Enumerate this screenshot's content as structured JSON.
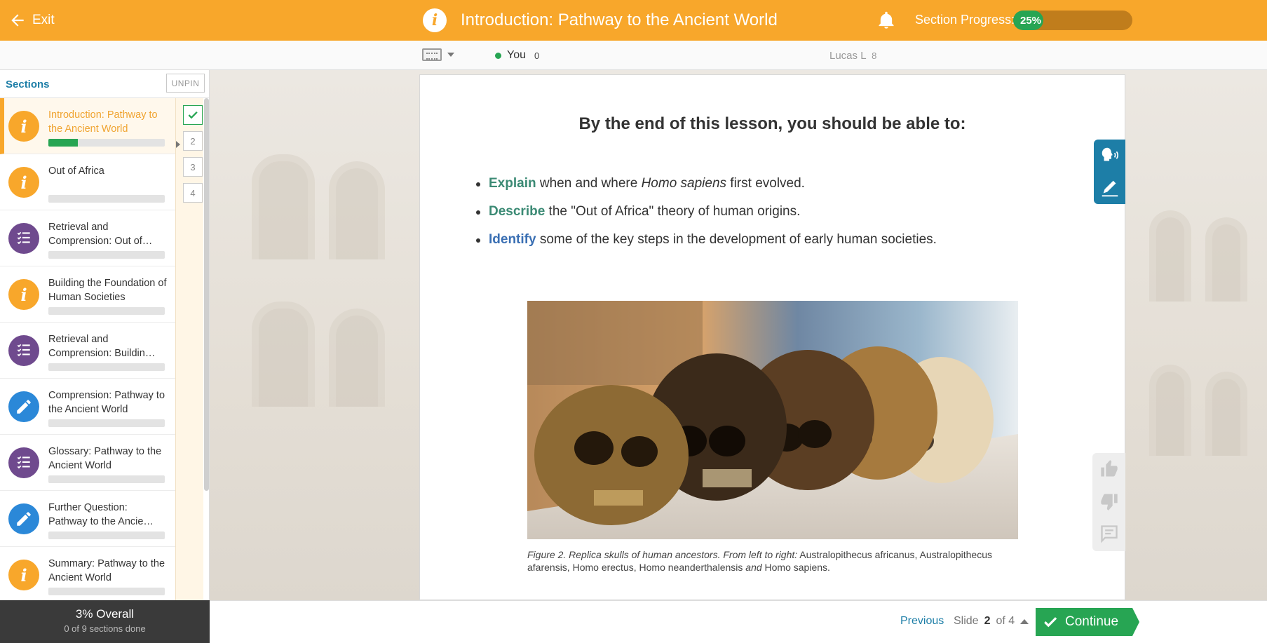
{
  "header": {
    "exit_label": "Exit",
    "title": "Introduction: Pathway to the Ancient World",
    "progress_label": "Section Progress:",
    "progress_percent": 25,
    "progress_text": "25%",
    "accent_color": "#f8a72b"
  },
  "presence": {
    "you_label": "You",
    "you_count": "0",
    "peer_name": "Lucas L",
    "peer_count": "8"
  },
  "sidebar": {
    "title": "Sections",
    "unpin_label": "UNPIN",
    "items": [
      {
        "label": "Introduction: Pathway to the Ancient World",
        "icon": "info-icon",
        "progress": 0.25,
        "active": true
      },
      {
        "label": "Out of Africa",
        "icon": "info-icon",
        "progress": 0
      },
      {
        "label": "Retrieval and Comprension: Out of…",
        "icon": "checklist-icon",
        "progress": 0
      },
      {
        "label": "Building the Foundation of Human Societies",
        "icon": "info-icon",
        "progress": 0
      },
      {
        "label": "Retrieval and Comprension: Buildin…",
        "icon": "checklist-icon",
        "progress": 0
      },
      {
        "label": "Comprension: Pathway to the Ancient World",
        "icon": "pencil-icon",
        "progress": 0
      },
      {
        "label": "Glossary: Pathway to the Ancient World",
        "icon": "checklist-icon",
        "progress": 0
      },
      {
        "label": "Further Question: Pathway to the Ancie…",
        "icon": "pencil-icon",
        "progress": 0
      },
      {
        "label": "Summary: Pathway to the Ancient World",
        "icon": "info-icon",
        "progress": 0
      }
    ],
    "slides": [
      "1",
      "2",
      "3",
      "4"
    ],
    "overall_main": "3% Overall",
    "overall_sub": "0 of 9 sections done"
  },
  "slide": {
    "heading": "By the end of this lesson, you should be able to:",
    "objectives": [
      {
        "keyword": "Explain",
        "pre": " when and where ",
        "italic": "Homo sapiens",
        "post": " first evolved."
      },
      {
        "keyword": "Describe",
        "pre": " the \"Out of Africa\" theory of human origins.",
        "italic": "",
        "post": ""
      },
      {
        "keyword": "Identify",
        "pre": " some of the key steps in the development of early human societies.",
        "italic": "",
        "post": ""
      }
    ],
    "caption_italic": "Figure 2. Replica skulls of human ancestors. From left to right:",
    "caption_species": " Australopithecus africanus, Australopithecus afarensis, Homo erectus, Homo neanderthalensis ",
    "caption_and": "and",
    "caption_last": " Homo sapiens."
  },
  "footer": {
    "previous_label": "Previous",
    "slide_word": "Slide",
    "slide_current": "2",
    "slide_of": "of 4",
    "continue_label": "Continue"
  }
}
